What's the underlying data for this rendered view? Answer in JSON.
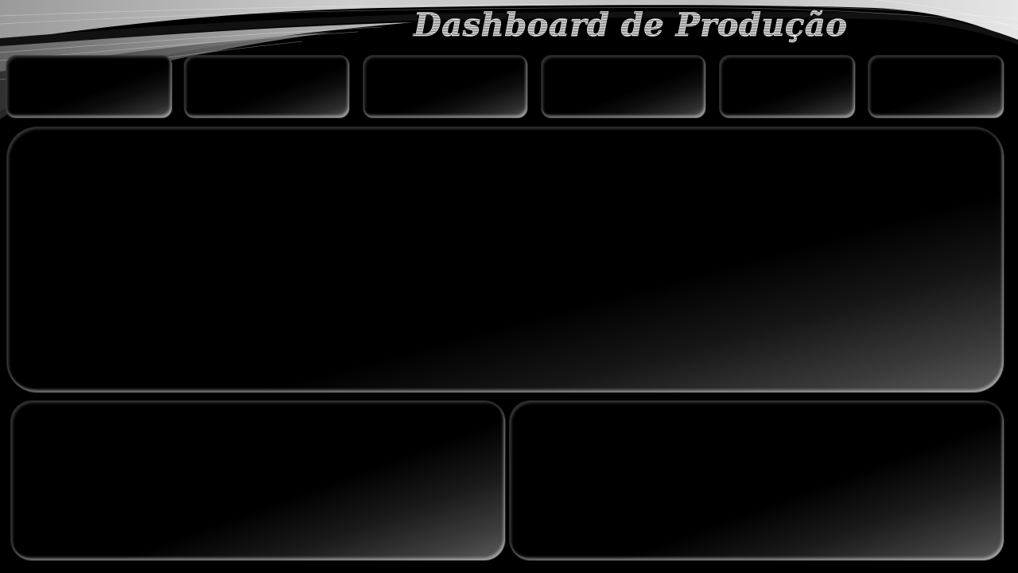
{
  "header": {
    "title": "Dashboard de Produção"
  },
  "theme": {
    "background": "#000000",
    "accent": "#cfcfcf"
  },
  "kpi_cards": [
    {
      "id": "kpi-1"
    },
    {
      "id": "kpi-2"
    },
    {
      "id": "kpi-3"
    },
    {
      "id": "kpi-4"
    },
    {
      "id": "kpi-5"
    },
    {
      "id": "kpi-6"
    }
  ],
  "panels": {
    "main": {
      "id": "main-chart-panel"
    },
    "bottom_left": {
      "id": "bottom-left-panel"
    },
    "bottom_right": {
      "id": "bottom-right-panel"
    }
  }
}
